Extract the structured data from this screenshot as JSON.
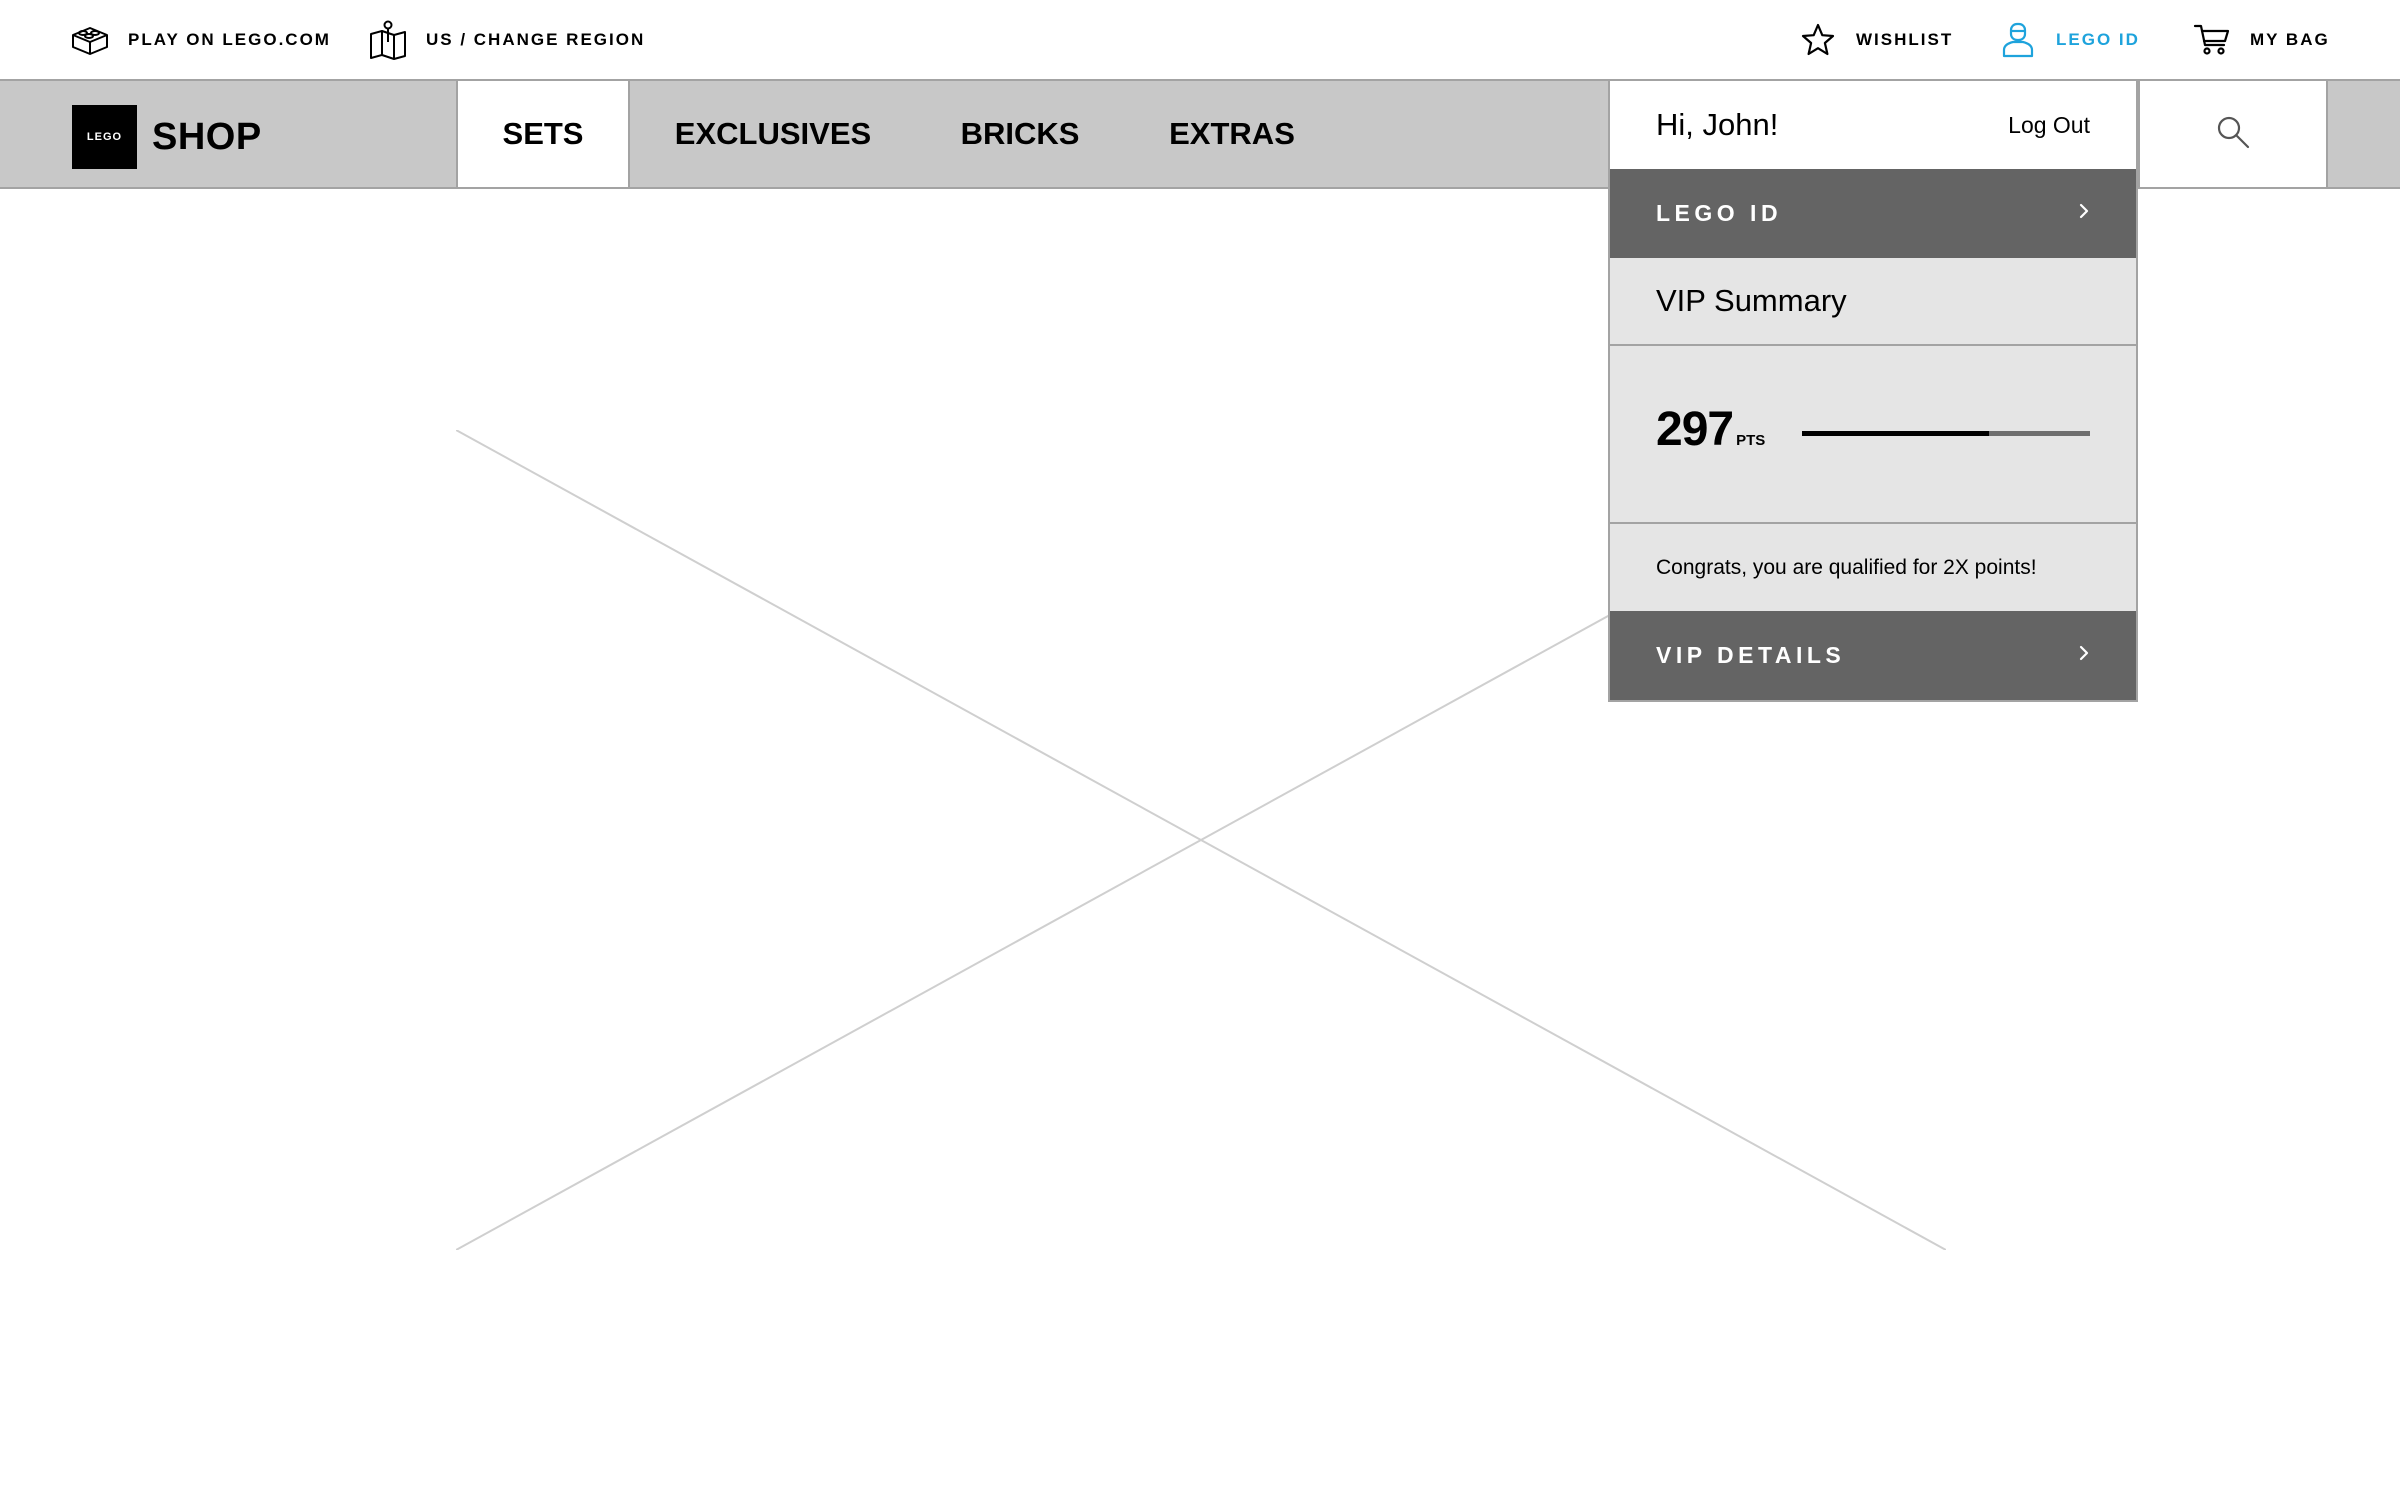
{
  "colors": {
    "accent": "#1ea3dc",
    "nav_background": "#c8c8c8",
    "dark_bar": "#646464",
    "panel_background": "#e5e5e5",
    "border": "#a3a3a3"
  },
  "utility_bar": {
    "play": {
      "label": "PLAY ON LEGO.COM",
      "icon": "lego-brick-icon"
    },
    "region": {
      "label": "US / CHANGE REGION",
      "icon": "map-pin-icon"
    },
    "wishlist": {
      "label": "WISHLIST",
      "icon": "star-icon"
    },
    "lego_id": {
      "label": "LEGO ID",
      "icon": "user-icon",
      "active": true
    },
    "bag": {
      "label": "MY BAG",
      "icon": "cart-icon"
    }
  },
  "nav": {
    "logo_text": "LEGO",
    "shop_label": "SHOP",
    "tabs": [
      {
        "label": "SETS",
        "active": true
      },
      {
        "label": "EXCLUSIVES",
        "active": false
      },
      {
        "label": "BRICKS",
        "active": false
      },
      {
        "label": "EXTRAS",
        "active": false
      }
    ],
    "search_icon": "search-icon"
  },
  "hero": {
    "image": "image-placeholder"
  },
  "account_dropdown": {
    "greeting": "Hi, John!",
    "logout_label": "Log Out",
    "lego_id_label": "LEGO ID",
    "vip_summary_label": "VIP Summary",
    "points_value": "297",
    "points_unit": "PTS",
    "points_progress": 0.65,
    "congrats_text": "Congrats, you are qualified for 2X points!",
    "vip_details_label": "VIP DETAILS",
    "chevron_icon": "chevron-right-icon"
  }
}
